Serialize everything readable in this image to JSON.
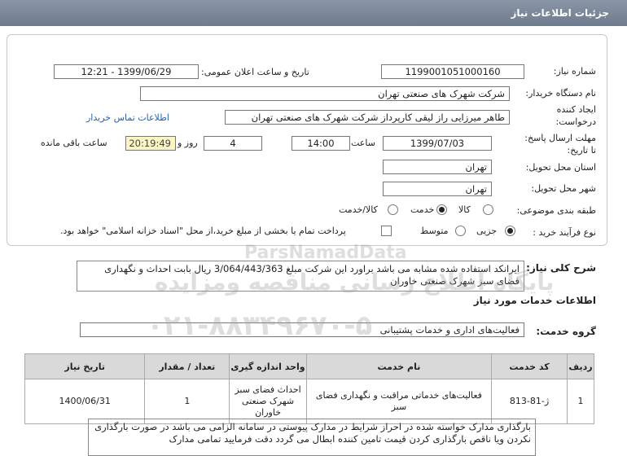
{
  "header": {
    "title": "جزئیات اطلاعات نیاز"
  },
  "form": {
    "need_number_label": "شماره نیاز:",
    "need_number": "1199001051000160",
    "announce_label": "تاریخ و ساعت اعلان عمومی:",
    "announce_value": "1399/06/29 - 12:21",
    "buyer_org_label": "نام دستگاه خریدار:",
    "buyer_org": "شرکت شهرک های صنعتی تهران",
    "creator_label_1": "ایجاد کننده",
    "creator_label_2": "درخواست:",
    "creator": "طاهر  میرزایی راز لیقی کارپرداز  شرکت شهرک های صنعتی تهران",
    "contact_link": "اطلاعات تماس خریدار",
    "deadline_label_1": "مهلت ارسال پاسخ:",
    "deadline_label_2": "تا تاریخ:",
    "deadline_date": "1399/07/03",
    "time_label": "ساعت",
    "deadline_time": "14:00",
    "days_value": "4",
    "days_label": "روز و",
    "remaining_time": "20:19:49",
    "remaining_label": "ساعت باقی مانده",
    "province_label": "استان محل تحویل:",
    "province": "تهران",
    "city_label": "شهر محل تحویل:",
    "city": "تهران",
    "category_label": "طبقه بندی موضوعی:",
    "category_options": [
      "کالا",
      "خدمت",
      "کالا/خدمت"
    ],
    "category_selected": "خدمت",
    "process_label": "نوع فرآیند خرید :",
    "process_options": [
      "جزیی",
      "متوسط"
    ],
    "process_selected": "جزیی",
    "payment_note": "پرداخت تمام یا بخشی از مبلغ خرید،از محل \"اسناد خزانه اسلامی\" خواهد بود."
  },
  "summary": {
    "label": "شرح کلی نیاز:",
    "text": "ایرانکد استفاده شده مشابه  می باشد براورد این شرکت مبلغ 3/064/443/363 ریال بابت احداث و نگهداری فضای سبز شهرک صنعتی خاوران"
  },
  "services": {
    "section_title": "اطلاعات خدمات مورد نیاز",
    "group_label": "گروه خدمت:",
    "group_value": "فعالیت‌های اداری و خدمات پشتیبانی"
  },
  "table": {
    "headers": [
      "ردیف",
      "کد خدمت",
      "نام خدمت",
      "واحد اندازه گیری",
      "تعداد / مقدار",
      "تاریخ نیاز"
    ],
    "rows": [
      {
        "index": "1",
        "code": "ژ-81-813",
        "name": "فعالیت‌های خدماتی مراقبت و نگهداری فضای سبز",
        "unit": "احداث فضای سبز شهرک صنعتی خاوران",
        "qty": "1",
        "date": "1400/06/31"
      }
    ]
  },
  "note": {
    "text": "بارگذاری مدارک خواسته شده در احراز شرایط در مدارک پیوستی در سامانه الزامی می باشد در صورت بارگذاری نکردن ویا ناقص بارگذاری کردن قیمت تامین کننده ابطال می گردد  دقت فرمایید تمامی مدارک"
  },
  "watermark": {
    "brand": "ParsNamadData",
    "line1": "پایگاه اطلاع رسانی مناقصه ومزایده",
    "line2": "۰۲۱-۸۸۳۴۹۶۷۰-۵"
  }
}
